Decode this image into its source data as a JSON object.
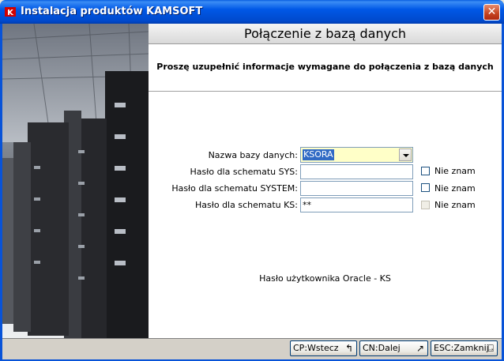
{
  "window": {
    "title": "Instalacja produktów KAMSOFT"
  },
  "header": {
    "title": "Połączenie z bazą danych",
    "subtitle": "Proszę uzupełnić informacje wymagane do połączenia z bazą danych"
  },
  "form": {
    "db_label": "Nazwa bazy danych:",
    "db_value": "KSORA",
    "sys_label": "Hasło dla schematu SYS:",
    "sys_value": "",
    "system_label": "Hasło dla schematu SYSTEM:",
    "system_value": "",
    "ks_label": "Hasło dla schematu KS:",
    "ks_value": "**",
    "dont_know": "Nie znam"
  },
  "info_text": "Hasło użytkownika Oracle - KS",
  "buttons": {
    "back": "CP:Wstecz",
    "next": "CN:Dalej",
    "close": "ESC:Zamknij"
  },
  "icons": {
    "back": "arrow-back-icon",
    "next": "arrow-next-icon",
    "close": "door-exit-icon"
  }
}
